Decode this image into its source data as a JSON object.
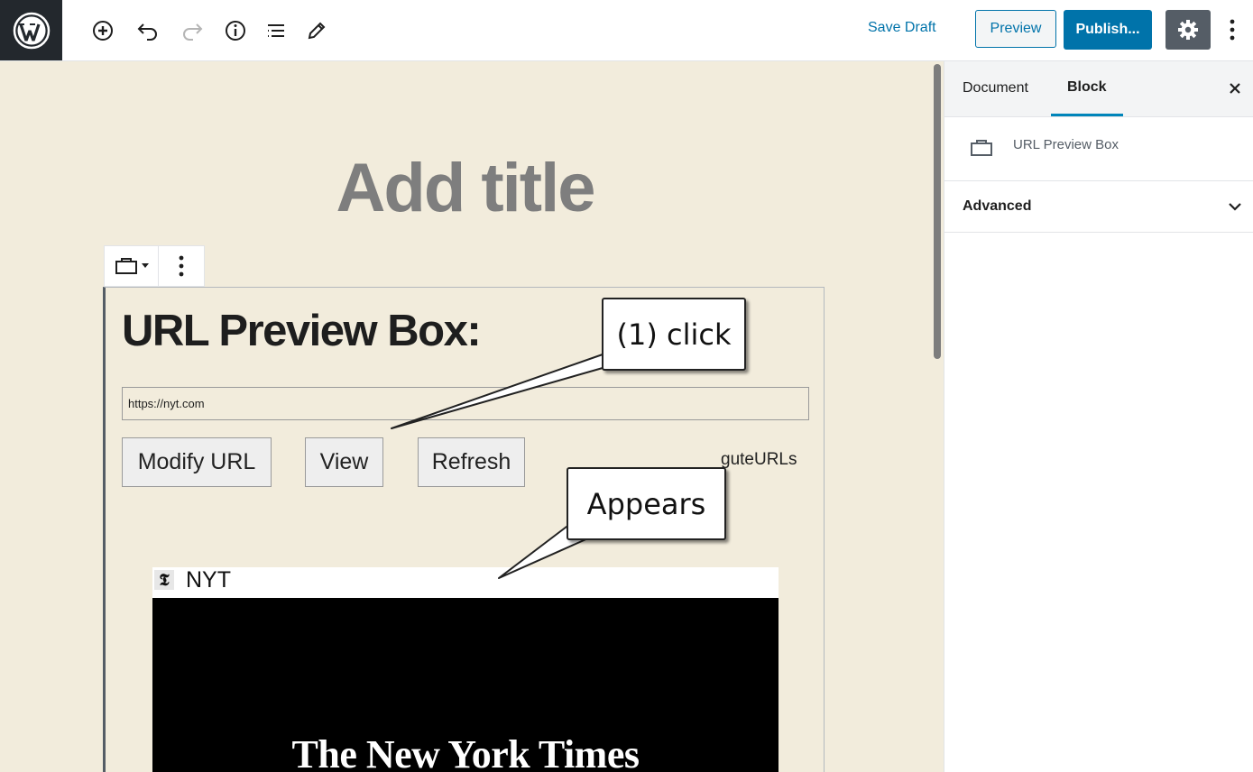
{
  "toolbar": {
    "save_draft": "Save Draft",
    "preview": "Preview",
    "publish": "Publish...",
    "icons": [
      "wordpress-logo",
      "add-block-icon",
      "undo-icon",
      "redo-icon",
      "info-icon",
      "outline-icon",
      "edit-tools-icon",
      "gear-icon",
      "more-vertical-icon"
    ]
  },
  "editor": {
    "title_placeholder": "Add title",
    "block": {
      "heading": "URL Preview Box:",
      "url_value": "https://nyt.com",
      "buttons": {
        "modify": "Modify URL",
        "view": "View",
        "refresh": "Refresh"
      },
      "brand": "guteURLs",
      "preview": {
        "favicon": "𝕿",
        "site_title": "NYT",
        "masthead": "The New York Times"
      }
    }
  },
  "annotations": {
    "click": "(1) click",
    "appears": "Appears"
  },
  "sidebar": {
    "tabs": [
      "Document",
      "Block"
    ],
    "active_tab": "Block",
    "block_name": "URL Preview Box",
    "advanced": "Advanced"
  },
  "colors": {
    "accent": "#0073aa",
    "canvas": "#f2ecdc",
    "header_dark": "#23282d"
  }
}
